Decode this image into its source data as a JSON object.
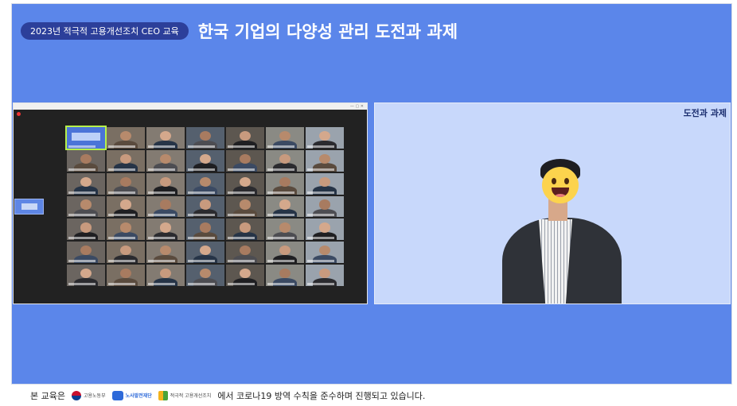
{
  "header": {
    "badge": "2023년 적극적 고용개선조치 CEO 교육",
    "title": "한국 기업의 다양성 관리 도전과 과제"
  },
  "speaker": {
    "corner_label": "도전과 과제"
  },
  "footer": {
    "prefix": "본 교육은",
    "logos": [
      "고용노동부",
      "노사발전재단",
      "적극적 고용개선조치"
    ],
    "suffix": "에서 코로나19 방역 수칙을 준수하며 진행되고 있습니다."
  },
  "colors": {
    "stage_background": "#5b86ea",
    "badge": "#2c3f9a",
    "speaker_panel": "#c8d8fb"
  },
  "icons": [
    "recording-icon",
    "taegeuk-logo-icon",
    "nosa-logo-icon",
    "aa-logo-icon",
    "smiley-face-icon"
  ]
}
